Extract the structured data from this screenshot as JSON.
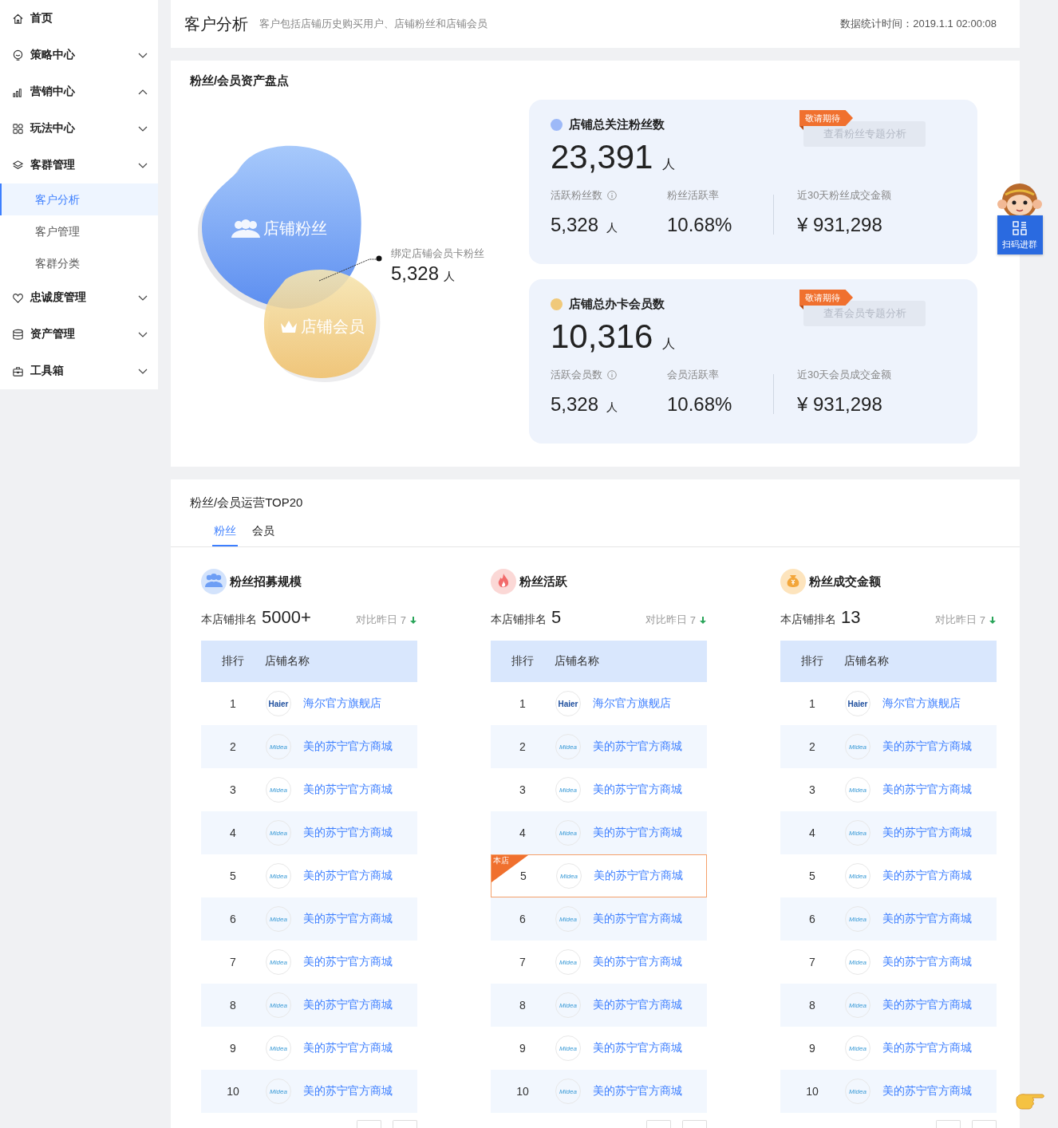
{
  "sidebar": {
    "items": [
      {
        "label": "首页",
        "kind": "link",
        "selected": false
      },
      {
        "label": "策略中心",
        "kind": "group",
        "expanded": false,
        "selected": false
      },
      {
        "label": "营销中心",
        "kind": "group",
        "expanded": true,
        "selected": false
      },
      {
        "label": "玩法中心",
        "kind": "group",
        "expanded": false,
        "selected": false
      },
      {
        "label": "客群管理",
        "kind": "group",
        "expanded": false,
        "selected": false,
        "children": [
          {
            "label": "客户分析",
            "selected": true
          },
          {
            "label": "客户管理",
            "selected": false
          },
          {
            "label": "客群分类",
            "selected": false
          }
        ]
      },
      {
        "label": "忠诚度管理",
        "kind": "group",
        "expanded": false,
        "selected": false
      },
      {
        "label": "资产管理",
        "kind": "group",
        "expanded": false,
        "selected": false
      },
      {
        "label": "工具箱",
        "kind": "group",
        "expanded": false,
        "selected": false
      }
    ]
  },
  "header": {
    "title": "客户分析",
    "subtitle": "客户包括店铺历史购买用户、店铺粉丝和店铺会员",
    "stat_time": "数据统计时间：2019.1.1 02:00:08"
  },
  "assets": {
    "title": "粉丝/会员资产盘点",
    "venn": {
      "fans_label": "店铺粉丝",
      "members_label": "店铺会员",
      "overlap_label": "绑定店铺会员卡粉丝",
      "overlap_value": "5,328",
      "overlap_unit": "人"
    },
    "cards": [
      {
        "title": "店铺总关注粉丝数",
        "color": "#9db9f8",
        "total": "23,391",
        "unit": "人",
        "badge": "敬请期待",
        "button": "查看粉丝专题分析",
        "disabled": true,
        "metrics": [
          {
            "label": "活跃粉丝数",
            "info": true,
            "value": "5,328",
            "unit": "人"
          },
          {
            "label": "粉丝活跃率",
            "value": "10.68%"
          },
          {
            "label": "近30天粉丝成交金额",
            "value": "¥ 931,298"
          }
        ]
      },
      {
        "title": "店铺总办卡会员数",
        "color": "#f0c97a",
        "total": "10,316",
        "unit": "人",
        "badge": "敬请期待",
        "button": "查看会员专题分析",
        "disabled": true,
        "metrics": [
          {
            "label": "活跃会员数",
            "info": true,
            "value": "5,328",
            "unit": "人"
          },
          {
            "label": "会员活跃率",
            "value": "10.68%"
          },
          {
            "label": "近30天会员成交金额",
            "value": "¥ 931,298"
          }
        ]
      }
    ]
  },
  "top20": {
    "title": "粉丝/会员运营TOP20",
    "tabs": [
      {
        "label": "粉丝",
        "selected": true
      },
      {
        "label": "会员",
        "selected": false
      }
    ],
    "boards": [
      {
        "title": "粉丝招募规模",
        "rank_label": "本店铺排名",
        "rank": "5000+",
        "compare_label": "对比昨日",
        "compare_value": "7",
        "falling": true,
        "columns": [
          "排行",
          "店铺名称"
        ],
        "rows": [
          {
            "rank": "1",
            "logo": "Haier",
            "name": "海尔官方旗舰店"
          },
          {
            "rank": "2",
            "logo": "Midea",
            "name": "美的苏宁官方商城"
          },
          {
            "rank": "3",
            "logo": "Midea",
            "name": "美的苏宁官方商城"
          },
          {
            "rank": "4",
            "logo": "Midea",
            "name": "美的苏宁官方商城"
          },
          {
            "rank": "5",
            "logo": "Midea",
            "name": "美的苏宁官方商城"
          },
          {
            "rank": "6",
            "logo": "Midea",
            "name": "美的苏宁官方商城"
          },
          {
            "rank": "7",
            "logo": "Midea",
            "name": "美的苏宁官方商城"
          },
          {
            "rank": "8",
            "logo": "Midea",
            "name": "美的苏宁官方商城"
          },
          {
            "rank": "9",
            "logo": "Midea",
            "name": "美的苏宁官方商城"
          },
          {
            "rank": "10",
            "logo": "Midea",
            "name": "美的苏宁官方商城"
          }
        ]
      },
      {
        "title": "粉丝活跃",
        "rank_label": "本店铺排名",
        "rank": "5",
        "compare_label": "对比昨日",
        "compare_value": "7",
        "falling": true,
        "columns": [
          "排行",
          "店铺名称"
        ],
        "rows": [
          {
            "rank": "1",
            "logo": "Haier",
            "name": "海尔官方旗舰店"
          },
          {
            "rank": "2",
            "logo": "Midea",
            "name": "美的苏宁官方商城"
          },
          {
            "rank": "3",
            "logo": "Midea",
            "name": "美的苏宁官方商城"
          },
          {
            "rank": "4",
            "logo": "Midea",
            "name": "美的苏宁官方商城"
          },
          {
            "rank": "5",
            "logo": "Midea",
            "name": "美的苏宁官方商城",
            "mine": true,
            "tag": "本店"
          },
          {
            "rank": "6",
            "logo": "Midea",
            "name": "美的苏宁官方商城"
          },
          {
            "rank": "7",
            "logo": "Midea",
            "name": "美的苏宁官方商城"
          },
          {
            "rank": "8",
            "logo": "Midea",
            "name": "美的苏宁官方商城"
          },
          {
            "rank": "9",
            "logo": "Midea",
            "name": "美的苏宁官方商城"
          },
          {
            "rank": "10",
            "logo": "Midea",
            "name": "美的苏宁官方商城"
          }
        ]
      },
      {
        "title": "粉丝成交金额",
        "rank_label": "本店铺排名",
        "rank": "13",
        "compare_label": "对比昨日",
        "compare_value": "7",
        "falling": true,
        "columns": [
          "排行",
          "店铺名称"
        ],
        "rows": [
          {
            "rank": "1",
            "logo": "Haier",
            "name": "海尔官方旗舰店"
          },
          {
            "rank": "2",
            "logo": "Midea",
            "name": "美的苏宁官方商城"
          },
          {
            "rank": "3",
            "logo": "Midea",
            "name": "美的苏宁官方商城"
          },
          {
            "rank": "4",
            "logo": "Midea",
            "name": "美的苏宁官方商城"
          },
          {
            "rank": "5",
            "logo": "Midea",
            "name": "美的苏宁官方商城"
          },
          {
            "rank": "6",
            "logo": "Midea",
            "name": "美的苏宁官方商城"
          },
          {
            "rank": "7",
            "logo": "Midea",
            "name": "美的苏宁官方商城"
          },
          {
            "rank": "8",
            "logo": "Midea",
            "name": "美的苏宁官方商城"
          },
          {
            "rank": "9",
            "logo": "Midea",
            "name": "美的苏宁官方商城"
          },
          {
            "rank": "10",
            "logo": "Midea",
            "name": "美的苏宁官方商城"
          }
        ]
      }
    ]
  },
  "widget": {
    "label": "扫码进群"
  }
}
